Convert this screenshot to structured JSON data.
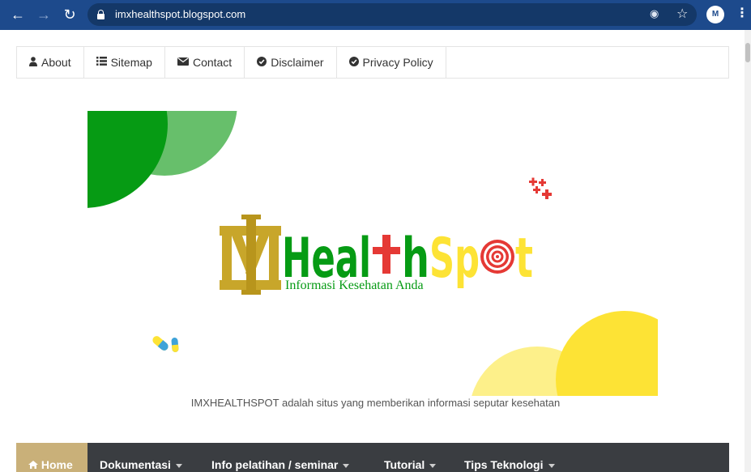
{
  "browser": {
    "url": "imxhealthspot.blogspot.com"
  },
  "top_menu": [
    {
      "label": "About",
      "icon": "user-icon"
    },
    {
      "label": "Sitemap",
      "icon": "list-icon"
    },
    {
      "label": "Contact",
      "icon": "envelope-icon"
    },
    {
      "label": "Disclaimer",
      "icon": "check-circle-icon"
    },
    {
      "label": "Privacy Policy",
      "icon": "check-circle-icon"
    }
  ],
  "logo": {
    "subtitle": "Informasi Kesehatan Anda"
  },
  "header": {
    "tagline": "IMXHEALTHSPOT adalah situs yang memberikan informasi seputar kesehatan"
  },
  "main_nav": {
    "home": "Home",
    "items": [
      "Dokumentasi",
      "Info pelatihan / seminar",
      "Tutorial",
      "Tips Teknologi"
    ]
  },
  "colors": {
    "chrome": "#1d4a8c",
    "green": "#069b14",
    "light_green": "#67bf6b",
    "yellow": "#fde335",
    "light_yellow": "#fdf08a",
    "red": "#e53935",
    "gold": "#c9b079",
    "nav_dark": "#3a3d41"
  }
}
